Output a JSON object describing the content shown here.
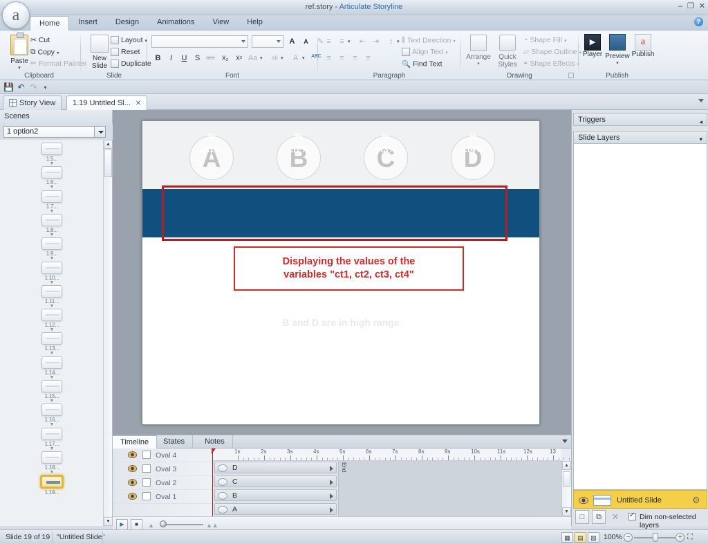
{
  "window": {
    "file_name": "ref.story",
    "separator": "-",
    "app_name": "Articulate Storyline",
    "minimize": "–",
    "restore": "❐",
    "close": "✕",
    "help": "?"
  },
  "ribbon": {
    "tabs": [
      {
        "label": "Home",
        "active": true
      },
      {
        "label": "Insert",
        "active": false
      },
      {
        "label": "Design",
        "active": false
      },
      {
        "label": "Animations",
        "active": false
      },
      {
        "label": "View",
        "active": false
      },
      {
        "label": "Help",
        "active": false
      }
    ],
    "groups": [
      {
        "name": "Clipboard"
      },
      {
        "name": "Slide"
      },
      {
        "name": "Font"
      },
      {
        "name": "Paragraph"
      },
      {
        "name": "Drawing"
      },
      {
        "name": "Publish"
      }
    ],
    "clipboard": {
      "paste": "Paste",
      "cut": "Cut",
      "copy": "Copy",
      "format_painter": "Format Painter"
    },
    "slide": {
      "new_slide": "New\nSlide",
      "new_slide_line1": "New",
      "new_slide_line2": "Slide",
      "layout": "Layout",
      "reset": "Reset",
      "duplicate": "Duplicate"
    },
    "font": {
      "font_name_value": "",
      "font_size_value": "",
      "grow_font": "A",
      "shrink_font": "A",
      "clear_format": "✎",
      "bold": "B",
      "italic": "I",
      "underline": "U",
      "shadow": "S",
      "strikethrough": "abc",
      "subscript": "X₂",
      "superscript": "X²",
      "change_case": "Aa",
      "text_highlight": "ab",
      "font_color": "A",
      "spelling": "ABC"
    },
    "paragraph": {
      "bullets": "≡",
      "numbering": "≡",
      "decrease_indent": "⇤",
      "increase_indent": "⇥",
      "line_spacing": "↕",
      "align_left": "≡",
      "align_center": "≡",
      "align_right": "≡",
      "justify": "≡",
      "text_direction": "Text Direction",
      "align_text": "Align Text",
      "find_text": "Find Text"
    },
    "drawing": {
      "arrange": "Arrange",
      "quick_styles_line1": "Quick",
      "quick_styles_line2": "Styles",
      "shape_fill": "Shape Fill",
      "shape_outline": "Shape Outline",
      "shape_effects": "Shape Effects"
    },
    "publish": {
      "player": "Player",
      "preview": "Preview",
      "publish": "Publish"
    }
  },
  "quick_access": {
    "save": "💾",
    "undo": "↶",
    "redo": "↷",
    "customize": "▾"
  },
  "doc_tabs": [
    {
      "label": "Story View",
      "active": false,
      "closable": false
    },
    {
      "label": "1.19 Untitled Sl...",
      "active": true,
      "closable": true,
      "close": "✕"
    }
  ],
  "scenes": {
    "header": "Scenes",
    "selected_scene": "1 option2",
    "thumbnails": [
      {
        "label": "1.5...",
        "selected": false
      },
      {
        "label": "1.6...",
        "selected": false
      },
      {
        "label": "1.7...",
        "selected": false
      },
      {
        "label": "1.8...",
        "selected": false
      },
      {
        "label": "1.9...",
        "selected": false
      },
      {
        "label": "1.10...",
        "selected": false
      },
      {
        "label": "1.11...",
        "selected": false
      },
      {
        "label": "1.12...",
        "selected": false
      },
      {
        "label": "1.13...",
        "selected": false
      },
      {
        "label": "1.14...",
        "selected": false
      },
      {
        "label": "1.15...",
        "selected": false
      },
      {
        "label": "1.16...",
        "selected": false
      },
      {
        "label": "1.17...",
        "selected": false
      },
      {
        "label": "1.18...",
        "selected": false
      },
      {
        "label": "1.19...",
        "selected": true
      }
    ]
  },
  "slide": {
    "circles": [
      "A",
      "B",
      "C",
      "D"
    ],
    "percent_columns": [
      {
        "top": "%",
        "bottom": "ct1%"
      },
      {
        "top": "%",
        "bottom": "ct2%"
      },
      {
        "top": "%",
        "bottom": "ct3%"
      },
      {
        "top": "%",
        "bottom": "ct4%"
      }
    ],
    "callout_line1": "Displaying the values of the",
    "callout_line2": "variables \"ct1, ct2, ct3, ct4\"",
    "faint_text": "B and D are in high range",
    "colors": {
      "blue_bar": "#114f7e",
      "selection_red": "#b41f24",
      "callout_red": "#cf2b2b",
      "circle_gray": "#c0c2c4"
    }
  },
  "timeline": {
    "tabs": [
      {
        "label": "Timeline",
        "active": true
      },
      {
        "label": "States",
        "active": false
      },
      {
        "label": "Notes",
        "active": false
      }
    ],
    "rows": [
      {
        "name": "Oval 4",
        "object": "D"
      },
      {
        "name": "Oval 3",
        "object": "C"
      },
      {
        "name": "Oval 2",
        "object": "B"
      },
      {
        "name": "Oval 1",
        "object": "A"
      }
    ],
    "ruler_labels": [
      "1s",
      "2s",
      "3s",
      "4s",
      "5s",
      "6s",
      "7s",
      "8s",
      "9s",
      "10s",
      "11s",
      "12s",
      "13"
    ],
    "end_marker": "End",
    "play": "▶",
    "stop": "■",
    "zoom_out_icon": "▲",
    "zoom_in_icon": "▲▲"
  },
  "right_panel": {
    "triggers_title": "Triggers",
    "triggers_collapse": "◂",
    "slide_layers_title": "Slide Layers",
    "slide_layers_caret": "▾",
    "layer_name": "Untitled Slide",
    "gear_icon": "⚙",
    "new_layer": "□",
    "duplicate_layer": "⧉",
    "delete_layer": "✕",
    "dim_layers_label": "Dim non-selected layers",
    "dim_layers_checked": true
  },
  "status_bar": {
    "slide_count": "Slide 19 of 19",
    "slide_name": "\"Untitled Slide\"",
    "zoom_value": "100%",
    "zoom_out": "−",
    "zoom_in": "+",
    "fit_icon": "⛶",
    "view_normal": "▦",
    "view_layers": "▤",
    "view_presenter": "▧"
  }
}
